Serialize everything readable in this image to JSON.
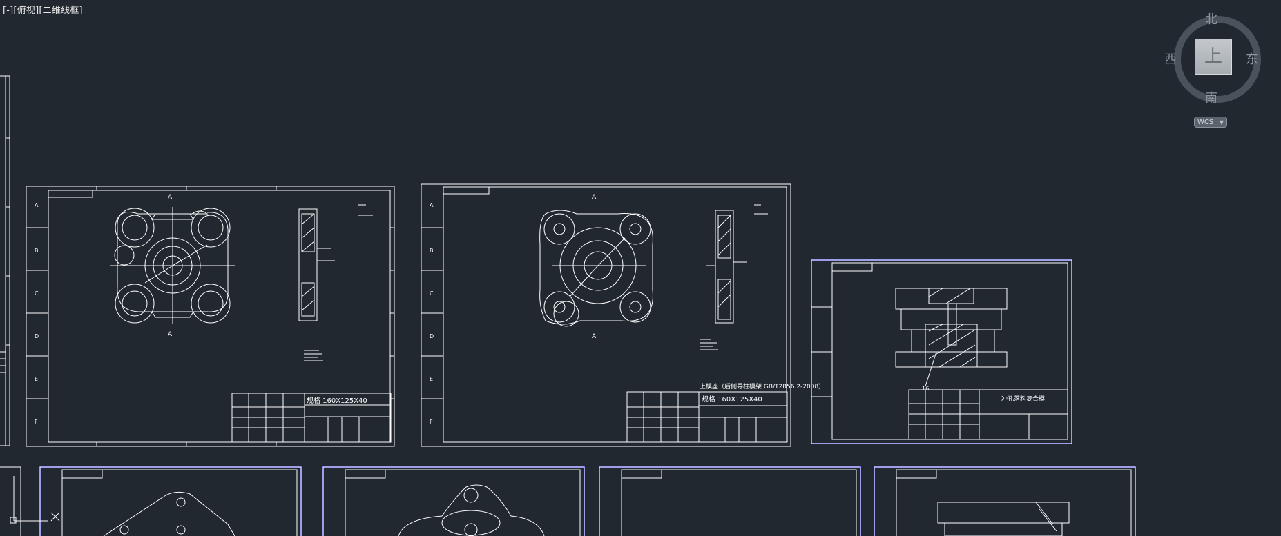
{
  "viewport_label": "[-][俯视][二维线框]",
  "viewcube": {
    "north": "北",
    "south": "南",
    "east": "东",
    "west": "西",
    "face": "上",
    "wcs_label": "WCS"
  },
  "colors": {
    "background": "#212830",
    "line": "#ffffff",
    "frame_blue": "#3b3bd0"
  },
  "sheets": {
    "s1": {
      "material": "规格 160X125X40",
      "section_top": "A",
      "section_bottom": "A",
      "rows": [
        "A",
        "B",
        "C",
        "D",
        "E",
        "F"
      ]
    },
    "s2": {
      "material": "规格 160X125X40",
      "standard": "上模座（后侧导柱模架 GB/T2856.2-2008）",
      "section_top": "A",
      "section_bottom": "A",
      "rows": [
        "A",
        "B",
        "C",
        "D",
        "E",
        "F"
      ]
    },
    "s3": {
      "name": "冲孔落料复合模",
      "callout": "16"
    }
  }
}
